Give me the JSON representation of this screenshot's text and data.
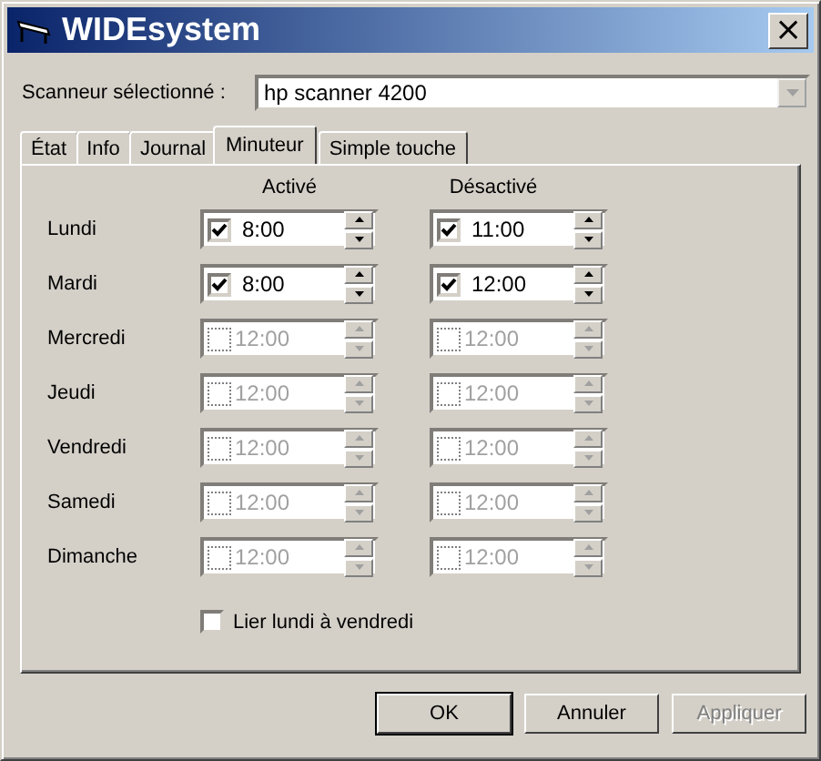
{
  "window": {
    "title": "WIDEsystem",
    "close": "×"
  },
  "scanner": {
    "label": "Scanneur sélectionné :",
    "value": "hp scanner 4200"
  },
  "tabs": [
    {
      "label": "État",
      "selected": false
    },
    {
      "label": "Info",
      "selected": false
    },
    {
      "label": "Journal",
      "selected": false
    },
    {
      "label": "Minuteur",
      "selected": true
    },
    {
      "label": "Simple touche",
      "selected": false
    }
  ],
  "columns": [
    "Activé",
    "Désactivé"
  ],
  "days": [
    {
      "name": "Lundi",
      "on": {
        "checked": true,
        "time": "8:00"
      },
      "off": {
        "checked": true,
        "time": "11:00"
      }
    },
    {
      "name": "Mardi",
      "on": {
        "checked": true,
        "time": "8:00"
      },
      "off": {
        "checked": true,
        "time": "12:00"
      }
    },
    {
      "name": "Mercredi",
      "on": {
        "checked": false,
        "time": "12:00"
      },
      "off": {
        "checked": false,
        "time": "12:00"
      }
    },
    {
      "name": "Jeudi",
      "on": {
        "checked": false,
        "time": "12:00"
      },
      "off": {
        "checked": false,
        "time": "12:00"
      }
    },
    {
      "name": "Vendredi",
      "on": {
        "checked": false,
        "time": "12:00"
      },
      "off": {
        "checked": false,
        "time": "12:00"
      }
    },
    {
      "name": "Samedi",
      "on": {
        "checked": false,
        "time": "12:00"
      },
      "off": {
        "checked": false,
        "time": "12:00"
      }
    },
    {
      "name": "Dimanche",
      "on": {
        "checked": false,
        "time": "12:00"
      },
      "off": {
        "checked": false,
        "time": "12:00"
      }
    }
  ],
  "link_weekdays": {
    "label": "Lier lundi à vendredi",
    "checked": false
  },
  "buttons": [
    {
      "label": "OK",
      "disabled": false
    },
    {
      "label": "Annuler",
      "disabled": false
    },
    {
      "label": "Appliquer",
      "disabled": true
    }
  ]
}
